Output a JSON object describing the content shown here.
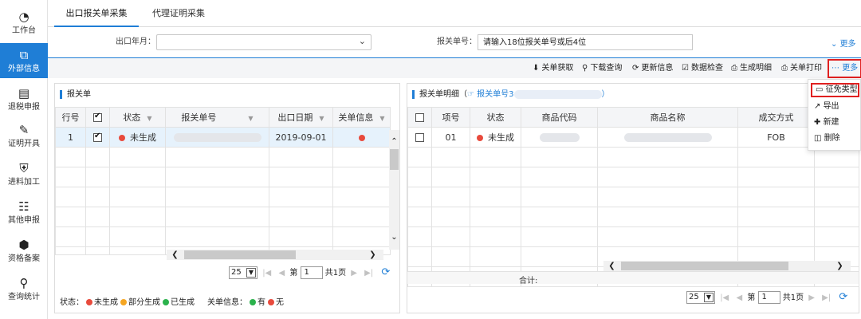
{
  "sidebar": {
    "items": [
      {
        "label": "工作台",
        "icon": "dashboard-icon",
        "active": false
      },
      {
        "label": "外部信息",
        "icon": "external-link-icon",
        "active": true
      },
      {
        "label": "退税申报",
        "icon": "document-icon",
        "active": false
      },
      {
        "label": "证明开具",
        "icon": "edit-icon",
        "active": false
      },
      {
        "label": "进料加工",
        "icon": "shield-icon",
        "active": false
      },
      {
        "label": "其他申报",
        "icon": "sitemap-icon",
        "active": false
      },
      {
        "label": "资格备案",
        "icon": "cube-icon",
        "active": false
      },
      {
        "label": "查询统计",
        "icon": "search-icon",
        "active": false
      }
    ]
  },
  "tabs": [
    {
      "label": "出口报关单采集",
      "active": true
    },
    {
      "label": "代理证明采集",
      "active": false
    }
  ],
  "filters": {
    "export_month_label": "出口年月：",
    "export_month_value": "",
    "customs_no_label": "报关单号：",
    "customs_no_placeholder": "请输入18位报关单号或后4位",
    "more_label": "更多"
  },
  "toolbar": {
    "buttons": [
      {
        "label": "关单获取",
        "icon": "download-icon"
      },
      {
        "label": "下载查询",
        "icon": "search-icon"
      },
      {
        "label": "更新信息",
        "icon": "refresh-icon"
      },
      {
        "label": "数据检查",
        "icon": "check-square-icon"
      },
      {
        "label": "生成明细",
        "icon": "print-icon"
      },
      {
        "label": "关单打印",
        "icon": "print-icon"
      }
    ],
    "more_label": "更多"
  },
  "dropdown": {
    "items": [
      {
        "label": "征免类型",
        "icon": "monitor-icon"
      },
      {
        "label": "导出",
        "icon": "export-icon"
      },
      {
        "label": "新建",
        "icon": "plus-icon"
      },
      {
        "label": "删除",
        "icon": "trash-icon"
      }
    ]
  },
  "left_panel": {
    "title": "报关单",
    "columns": [
      "行号",
      "",
      "状态",
      "报关单号",
      "出口日期",
      "关单信息"
    ],
    "rows": [
      {
        "row_no": "1",
        "status": "未生成",
        "status_color": "#e84a3c",
        "date": "2019-09-01",
        "info_color": "#e84a3c"
      }
    ],
    "pager": {
      "page_size": "25",
      "page_prefix": "第",
      "page": "1",
      "total": "共1页"
    }
  },
  "right_panel": {
    "title": "报关单明细（",
    "link_prefix": "报关单号3",
    "title_suffix": "）",
    "columns": [
      "",
      "项号",
      "状态",
      "商品代码",
      "商品名称",
      "成交方式",
      "成"
    ],
    "rows": [
      {
        "item_no": "01",
        "status": "未生成",
        "status_color": "#e84a3c",
        "deal": "FOB"
      }
    ],
    "total_label": "合计:",
    "pager": {
      "page_size": "25",
      "page_prefix": "第",
      "page": "1",
      "total": "共1页"
    }
  },
  "legend": {
    "status_label": "状态：",
    "s1": "未生成",
    "s1_color": "#e84a3c",
    "s2": "部分生成",
    "s2_color": "#f5a623",
    "s3": "已生成",
    "s3_color": "#2bb24c",
    "info_label": "关单信息：",
    "i1": "有",
    "i1_color": "#2bb24c",
    "i2": "无",
    "i2_color": "#e84a3c"
  }
}
